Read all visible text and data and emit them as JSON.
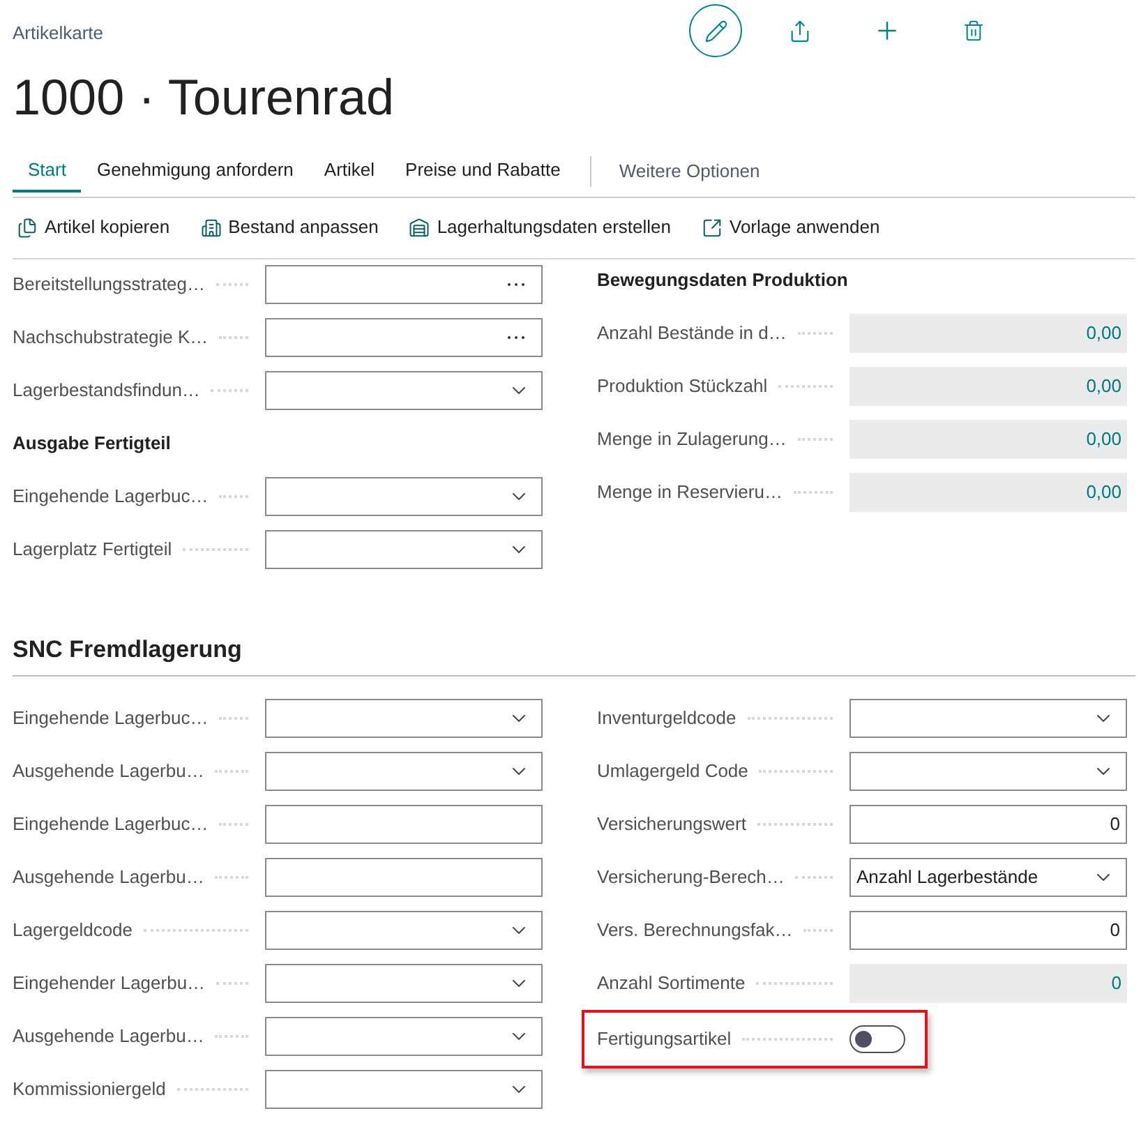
{
  "page": {
    "caption": "Artikelkarte",
    "title": "1000 · Tourenrad"
  },
  "tabs": [
    {
      "label": "Start",
      "selected": true
    },
    {
      "label": "Genehmigung anfordern",
      "selected": false
    },
    {
      "label": "Artikel",
      "selected": false
    },
    {
      "label": "Preise und Rabatte",
      "selected": false
    }
  ],
  "more_options": "Weitere Optionen",
  "actions": [
    {
      "kind": "copy",
      "label": "Artikel kopieren"
    },
    {
      "kind": "stock",
      "label": "Bestand anpassen"
    },
    {
      "kind": "warehouse",
      "label": "Lagerhaltungsdaten erstellen"
    },
    {
      "kind": "template",
      "label": "Vorlage anwenden"
    }
  ],
  "upper_left": [
    {
      "kind": "lookup",
      "label": "Bereitstellungsstrateg…"
    },
    {
      "kind": "lookup",
      "label": "Nachschubstrategie K…"
    },
    {
      "kind": "dropdown",
      "label": "Lagerbestandsfindun…"
    },
    {
      "kind": "heading",
      "label": "Ausgabe Fertigteil"
    },
    {
      "kind": "dropdown",
      "label": "Eingehende Lagerbuc…"
    },
    {
      "kind": "dropdown",
      "label": "Lagerplatz Fertigteil"
    }
  ],
  "upper_right": [
    {
      "kind": "heading",
      "label": "Bewegungsdaten Produktion"
    },
    {
      "kind": "readonly",
      "label": "Anzahl Bestände in d…",
      "value": "0,00"
    },
    {
      "kind": "readonly",
      "label": "Produktion Stückzahl",
      "value": "0,00"
    },
    {
      "kind": "readonly",
      "label": "Menge in Zulagerung…",
      "value": "0,00"
    },
    {
      "kind": "readonly",
      "label": "Menge in Reservieru…",
      "value": "0,00"
    }
  ],
  "snc": {
    "title": "SNC Fremdlagerung",
    "left": [
      {
        "kind": "dropdown",
        "label": "Eingehende Lagerbuc…"
      },
      {
        "kind": "dropdown",
        "label": "Ausgehende Lagerbu…"
      },
      {
        "kind": "text",
        "label": "Eingehende Lagerbuc…"
      },
      {
        "kind": "text",
        "label": "Ausgehende Lagerbu…"
      },
      {
        "kind": "dropdown",
        "label": "Lagergeldcode"
      },
      {
        "kind": "dropdown",
        "label": "Eingehender Lagerbu…"
      },
      {
        "kind": "dropdown",
        "label": "Ausgehende Lagerbu…"
      },
      {
        "kind": "dropdown",
        "label": "Kommissioniergeld"
      }
    ],
    "right": [
      {
        "kind": "dropdown",
        "label": "Inventurgeldcode",
        "highlighted": false
      },
      {
        "kind": "dropdown",
        "label": "Umlagergeld Code",
        "highlighted": false
      },
      {
        "kind": "text",
        "label": "Versicherungswert",
        "value": "0",
        "highlighted": false
      },
      {
        "kind": "dropdown",
        "label": "Versicherung-Berech…",
        "value": "Anzahl Lagerbestände",
        "highlighted": false
      },
      {
        "kind": "text",
        "label": "Vers. Berechnungsfak…",
        "value": "0",
        "highlighted": false
      },
      {
        "kind": "readonly",
        "label": "Anzahl Sortimente",
        "value": "0",
        "highlighted": false
      },
      {
        "kind": "toggle",
        "label": "Fertigungsartikel",
        "on": false,
        "highlighted": true
      }
    ]
  }
}
